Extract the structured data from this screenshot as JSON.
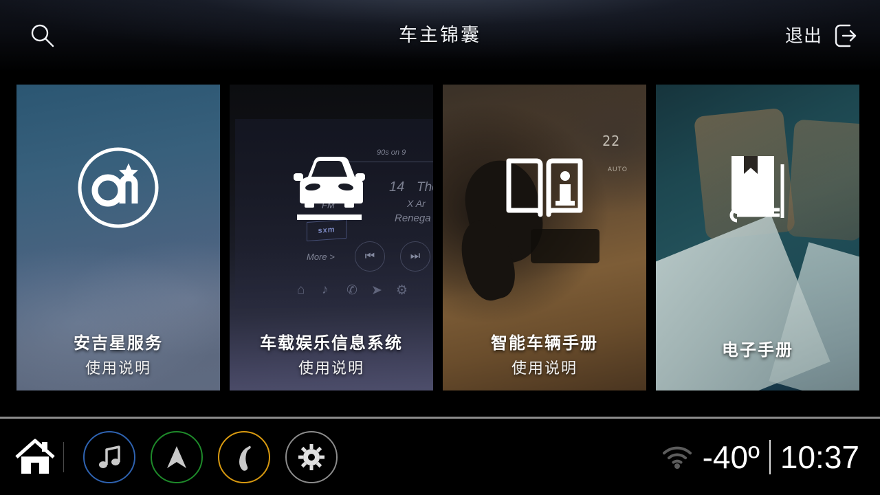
{
  "header": {
    "title": "车主锦囊",
    "search_icon": "search-icon",
    "exit_label": "退出",
    "exit_icon": "logout-icon"
  },
  "tiles": [
    {
      "id": "onstar",
      "icon": "onstar-logo-icon",
      "title": "安吉星服务",
      "subtitle": "使用说明",
      "bg_top": "#2b5672",
      "bg_bottom": "#5f6a80"
    },
    {
      "id": "infotainment",
      "icon": "car-front-icon",
      "title": "车载娱乐信息系统",
      "subtitle": "使用说明",
      "bg_top": "#0c0d10",
      "bg_bottom": "#4d4e6b",
      "screen_text": {
        "station": "90s on 9",
        "channel": "14",
        "track": "The",
        "artist": "X Ar",
        "album": "Renega",
        "band": "FM",
        "brand": "sxm",
        "more": "More >"
      }
    },
    {
      "id": "vehicle-manual",
      "icon": "open-book-info-icon",
      "title": "智能车辆手册",
      "subtitle": "使用说明",
      "bg_top": "#3a3128",
      "bg_bottom": "#4a3520",
      "climate_temp": "22",
      "climate_mode": "AUTO"
    },
    {
      "id": "ebook-manual",
      "icon": "closed-book-icon",
      "title": "电子手册",
      "subtitle": "",
      "bg_top": "#16343c",
      "bg_bottom": "#122a38"
    }
  ],
  "bottombar": {
    "home_icon": "home-icon",
    "buttons": [
      {
        "icon": "music-note-icon",
        "ring_color": "#2e62b0"
      },
      {
        "icon": "navigation-arrow-icon",
        "ring_color": "#1e8a2a"
      },
      {
        "icon": "phone-icon",
        "ring_color": "#d99a10"
      },
      {
        "icon": "gear-icon",
        "ring_color": "#8c8c8c"
      }
    ],
    "status": {
      "wifi_icon": "wifi-icon",
      "temperature": "-40º",
      "time": "10:37"
    }
  }
}
